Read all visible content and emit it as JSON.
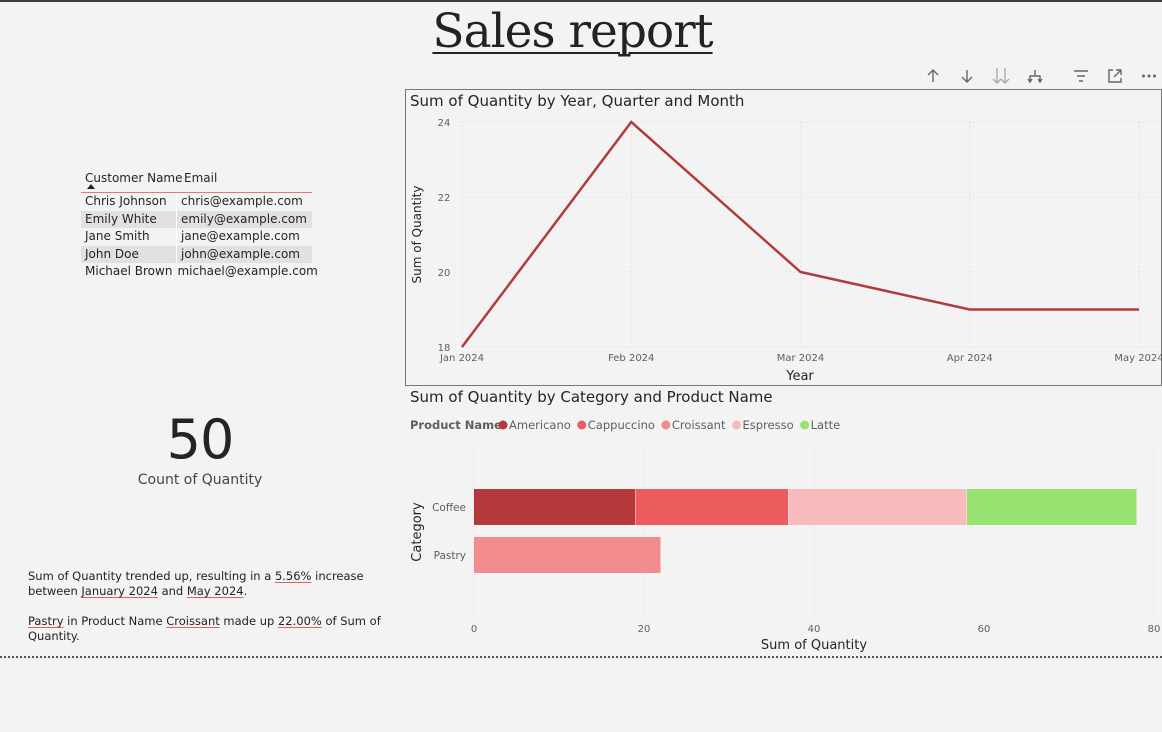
{
  "page": {
    "title": "Sales report"
  },
  "toolbar": {
    "icons": [
      "arrow-up-icon",
      "arrow-down-icon",
      "double-arrow-down-icon",
      "expand-hierarchy-icon",
      "filter-icon",
      "focus-mode-icon",
      "more-options-icon"
    ]
  },
  "table": {
    "columns": [
      "Customer Name",
      "Email"
    ],
    "rows": [
      [
        "Chris Johnson",
        "chris@example.com"
      ],
      [
        "Emily White",
        "emily@example.com"
      ],
      [
        "Jane Smith",
        "jane@example.com"
      ],
      [
        "John Doe",
        "john@example.com"
      ],
      [
        "Michael Brown",
        "michael@example.com"
      ]
    ]
  },
  "card": {
    "value": "50",
    "label": "Count of Quantity"
  },
  "narrative": {
    "p1": {
      "a": "Sum of Quantity trended up, resulting in a ",
      "b": "5.56%",
      "c": " increase between ",
      "d": "January 2024",
      "e": " and ",
      "f": "May 2024",
      "g": "."
    },
    "p2": {
      "a": "Pastry",
      "b": " in Product Name ",
      "c": "Croissant",
      "d": " made up ",
      "e": "22.00%",
      "f": " of Sum of Quantity."
    }
  },
  "colors": {
    "line": "#b23a3a",
    "americano": "#b5393b",
    "cappuccino": "#ec5b5d",
    "croissant": "#f28b8d",
    "espresso": "#f8bbbb",
    "latte": "#98e26f"
  },
  "chart_data": [
    {
      "type": "line",
      "title": "Sum of Quantity by Year, Quarter and Month",
      "xlabel": "Year",
      "ylabel": "Sum of Quantity",
      "categories": [
        "Jan 2024",
        "Feb 2024",
        "Mar 2024",
        "Apr 2024",
        "May 2024"
      ],
      "values": [
        18,
        24,
        20,
        19,
        19
      ],
      "ylim": [
        18,
        24
      ],
      "yticks": [
        18,
        20,
        22,
        24
      ],
      "grid": true
    },
    {
      "type": "bar",
      "orientation": "horizontal",
      "stacked": true,
      "title": "Sum of Quantity by Category and Product Name",
      "xlabel": "Sum of Quantity",
      "ylabel": "Category",
      "legend_title": "Product Name",
      "legend_position": "top-left",
      "categories": [
        "Coffee",
        "Pastry"
      ],
      "series": [
        {
          "name": "Americano",
          "values": [
            19,
            0
          ]
        },
        {
          "name": "Cappuccino",
          "values": [
            18,
            0
          ]
        },
        {
          "name": "Croissant",
          "values": [
            0,
            22
          ]
        },
        {
          "name": "Espresso",
          "values": [
            21,
            0
          ]
        },
        {
          "name": "Latte",
          "values": [
            20,
            0
          ]
        }
      ],
      "xlim": [
        0,
        80
      ],
      "xticks": [
        0,
        20,
        40,
        60,
        80
      ],
      "grid": true
    }
  ]
}
